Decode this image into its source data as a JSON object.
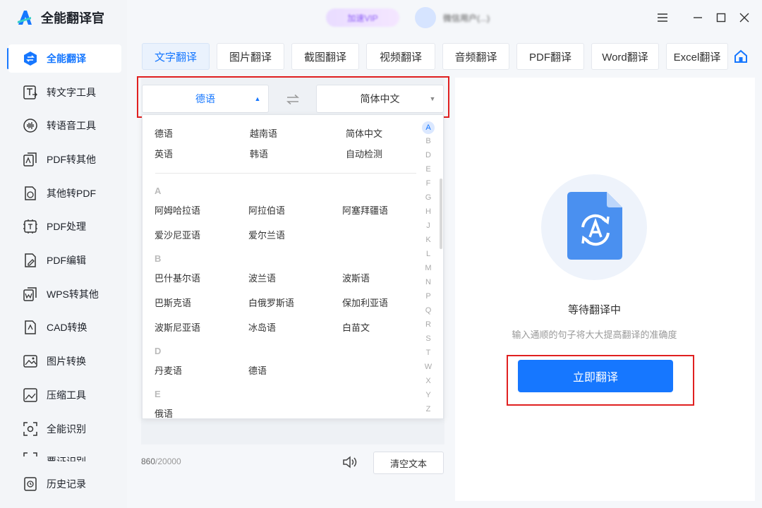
{
  "app": {
    "title": "全能翻译官"
  },
  "topbar": {
    "vip_label": "加速VIP",
    "user_name": "微信用户(...)"
  },
  "sidebar": {
    "items": [
      {
        "label": "全能翻译",
        "icon": "translate-icon",
        "active": true
      },
      {
        "label": "转文字工具",
        "icon": "text-tool-icon"
      },
      {
        "label": "转语音工具",
        "icon": "voice-tool-icon"
      },
      {
        "label": "PDF转其他",
        "icon": "pdf-convert-icon"
      },
      {
        "label": "其他转PDF",
        "icon": "to-pdf-icon"
      },
      {
        "label": "PDF处理",
        "icon": "pdf-process-icon"
      },
      {
        "label": "PDF编辑",
        "icon": "pdf-edit-icon"
      },
      {
        "label": "WPS转其他",
        "icon": "wps-icon"
      },
      {
        "label": "CAD转换",
        "icon": "cad-icon"
      },
      {
        "label": "图片转换",
        "icon": "image-convert-icon"
      },
      {
        "label": "压缩工具",
        "icon": "compress-icon"
      },
      {
        "label": "全能识别",
        "icon": "recognize-icon"
      },
      {
        "label": "票证识别",
        "icon": "ticket-icon"
      },
      {
        "label": "历史记录",
        "icon": "history-icon"
      }
    ]
  },
  "tabs": [
    "文字翻译",
    "图片翻译",
    "截图翻译",
    "视频翻译",
    "音频翻译",
    "PDF翻译",
    "Word翻译",
    "Excel翻译"
  ],
  "source_lang": "德语",
  "target_lang": "简体中文",
  "dropdown": {
    "recent": [
      "德语",
      "越南语",
      "简体中文",
      "英语",
      "韩语",
      "自动检测"
    ],
    "groups": [
      {
        "letter": "A",
        "items": [
          "阿姆哈拉语",
          "阿拉伯语",
          "阿塞拜疆语",
          "爱沙尼亚语",
          "爱尔兰语"
        ]
      },
      {
        "letter": "B",
        "items": [
          "巴什基尔语",
          "波兰语",
          "波斯语",
          "巴斯克语",
          "白俄罗斯语",
          "保加利亚语",
          "波斯尼亚语",
          "冰岛语",
          "白苗文"
        ]
      },
      {
        "letter": "D",
        "items": [
          "丹麦语",
          "德语"
        ]
      },
      {
        "letter": "E",
        "items": [
          "俄语"
        ]
      }
    ],
    "alphabet": [
      "A",
      "B",
      "D",
      "E",
      "F",
      "G",
      "H",
      "J",
      "K",
      "L",
      "M",
      "N",
      "P",
      "Q",
      "R",
      "S",
      "T",
      "W",
      "X",
      "Y",
      "Z"
    ]
  },
  "footer": {
    "char_count": "860",
    "char_limit": "/20000",
    "clear_label": "清空文本"
  },
  "right": {
    "status_title": "等待翻译中",
    "status_sub": "输入通顺的句子将大大提高翻译的准确度",
    "translate_label": "立即翻译"
  },
  "colors": {
    "accent": "#1677ff",
    "highlight": "#e02020"
  }
}
